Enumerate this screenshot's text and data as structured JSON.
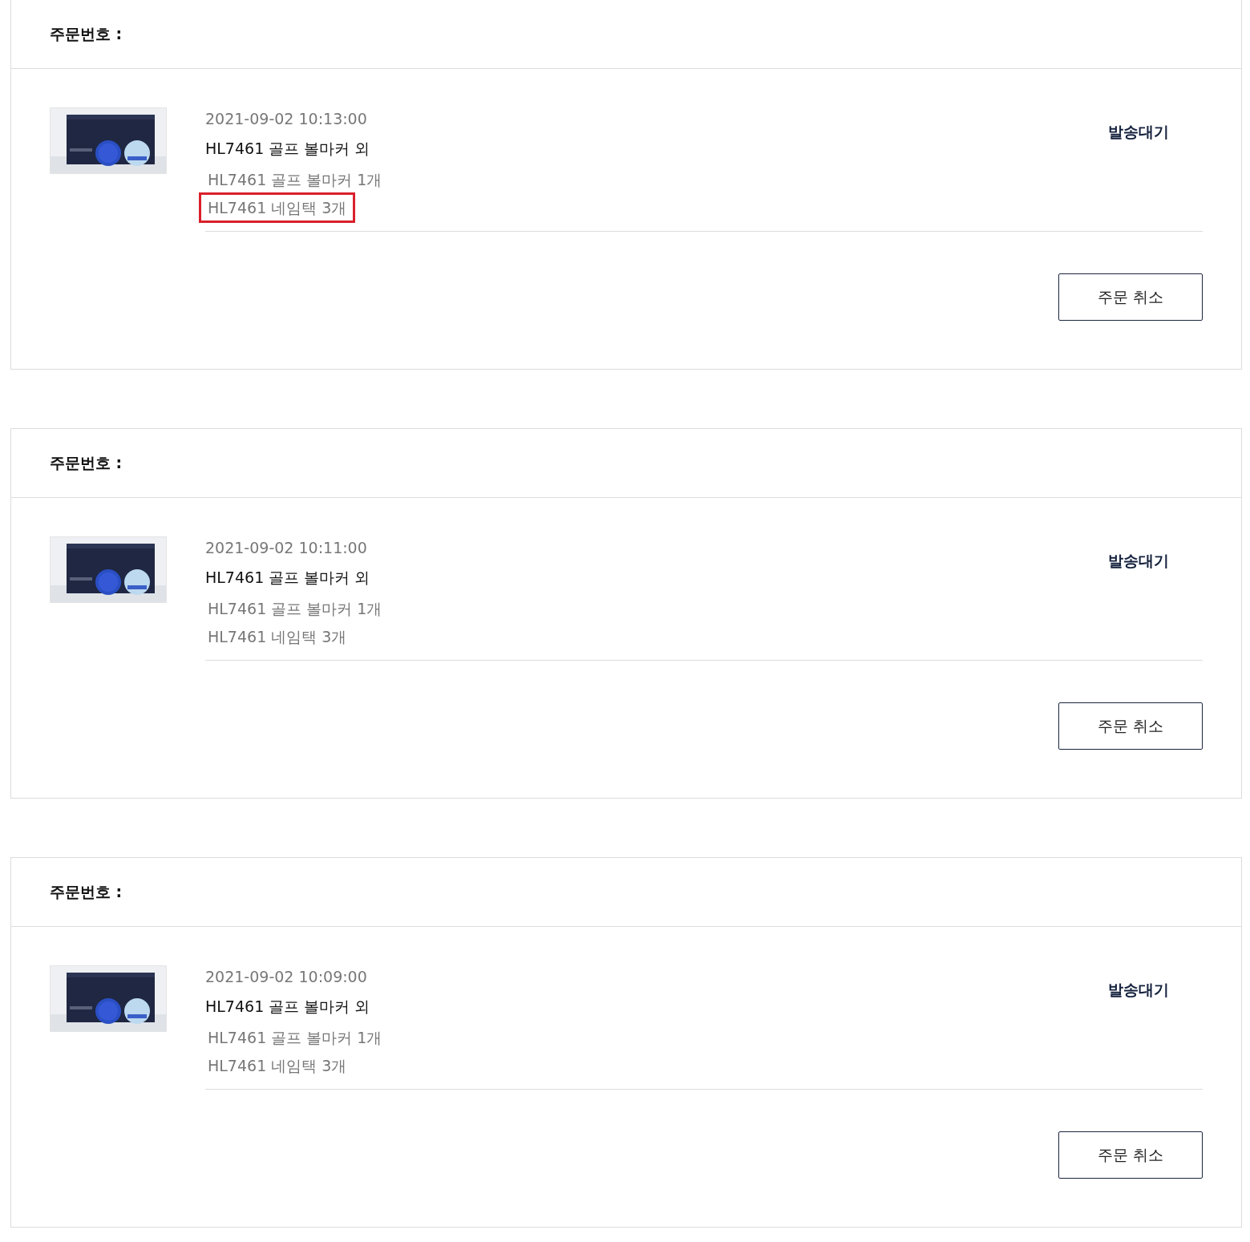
{
  "orders": [
    {
      "order_label": "주문번호 :",
      "date": "2021-09-02 10:13:00",
      "title": "HL7461 골프 볼마커 외",
      "items": [
        {
          "text": "HL7461 골프 볼마커 1개",
          "highlighted": false
        },
        {
          "text": "HL7461 네임택 3개",
          "highlighted": true
        }
      ],
      "status": "발송대기",
      "cancel_button": "주문 취소"
    },
    {
      "order_label": "주문번호 :",
      "date": "2021-09-02 10:11:00",
      "title": "HL7461 골프 볼마커 외",
      "items": [
        {
          "text": "HL7461 골프 볼마커 1개",
          "highlighted": false
        },
        {
          "text": "HL7461 네임택 3개",
          "highlighted": false
        }
      ],
      "status": "발송대기",
      "cancel_button": "주문 취소"
    },
    {
      "order_label": "주문번호 :",
      "date": "2021-09-02 10:09:00",
      "title": "HL7461 골프 볼마커 외",
      "items": [
        {
          "text": "HL7461 골프 볼마커 1개",
          "highlighted": false
        },
        {
          "text": "HL7461 네임택 3개",
          "highlighted": false
        }
      ],
      "status": "발송대기",
      "cancel_button": "주문 취소"
    }
  ]
}
